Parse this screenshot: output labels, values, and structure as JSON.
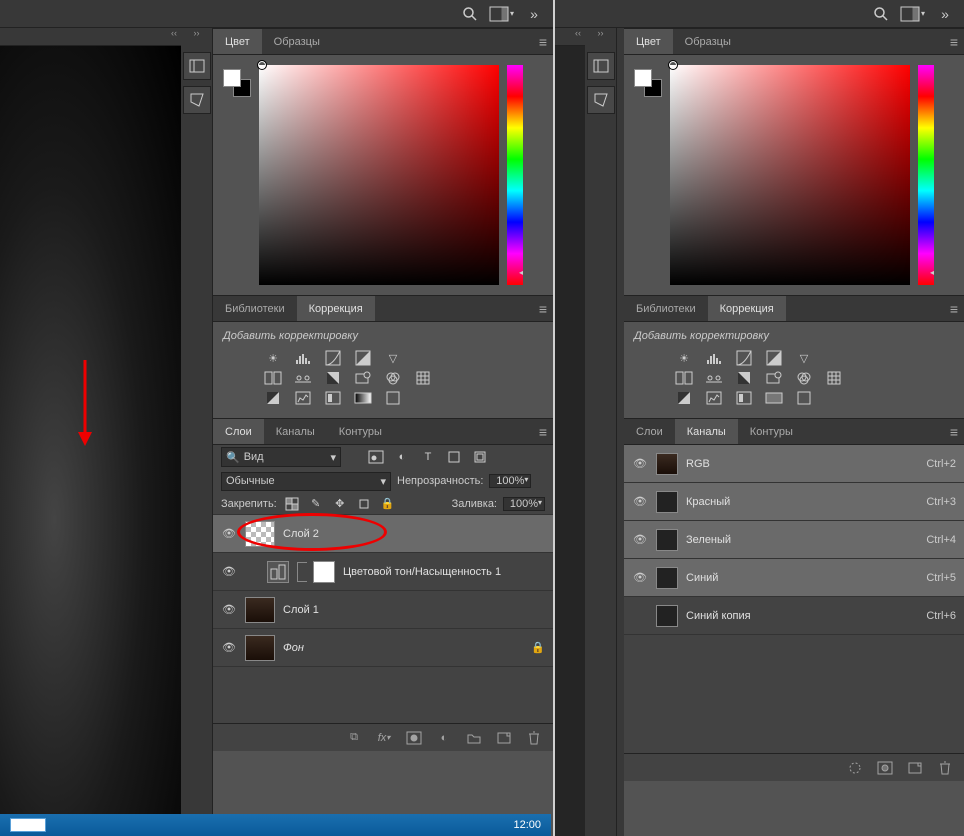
{
  "topbar": {
    "search_icon": "search",
    "panel_icon": "panels"
  },
  "color_panel": {
    "tab_color": "Цвет",
    "tab_swatches": "Образцы"
  },
  "libraries_panel": {
    "tab_libraries": "Библиотеки",
    "tab_adjustments": "Коррекция",
    "add_adjustment": "Добавить корректировку"
  },
  "layers_panel": {
    "tab_layers": "Слои",
    "tab_channels": "Каналы",
    "tab_paths": "Контуры",
    "search_kind": "Вид",
    "blend_mode": "Обычные",
    "opacity_label": "Непрозрачность:",
    "opacity_value": "100%",
    "fill_label": "Заливка:",
    "fill_value": "100%",
    "lock_label": "Закрепить:",
    "layers": [
      {
        "name": "Слой 2",
        "selected": true,
        "thumb": "checker"
      },
      {
        "name": "Цветовой тон/Насыщенность 1",
        "adj": true
      },
      {
        "name": "Слой 1",
        "thumb": "portrait"
      },
      {
        "name": "Фон",
        "thumb": "portrait",
        "locked": true,
        "italic": true
      }
    ]
  },
  "channels_panel": {
    "items": [
      {
        "name": "RGB",
        "shortcut": "Ctrl+2",
        "visible": true
      },
      {
        "name": "Красный",
        "shortcut": "Ctrl+3",
        "visible": true
      },
      {
        "name": "Зеленый",
        "shortcut": "Ctrl+4",
        "visible": true
      },
      {
        "name": "Синий",
        "shortcut": "Ctrl+5",
        "visible": true
      },
      {
        "name": "Синий копия",
        "shortcut": "Ctrl+6",
        "visible": false
      }
    ]
  },
  "taskbar": {
    "time": "12:00"
  }
}
